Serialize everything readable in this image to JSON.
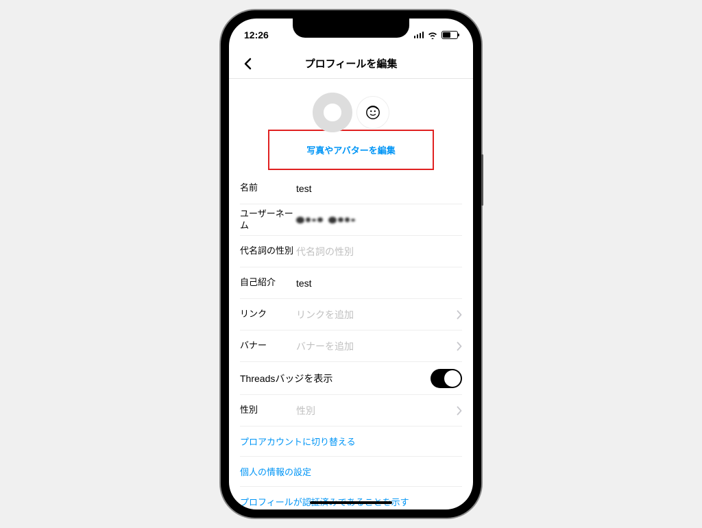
{
  "status": {
    "time": "12:26"
  },
  "nav": {
    "title": "プロフィールを編集"
  },
  "avatar": {
    "edit_link": "写真やアバターを編集"
  },
  "fields": {
    "name": {
      "label": "名前",
      "value": "test"
    },
    "username": {
      "label": "ユーザーネーム"
    },
    "pronouns": {
      "label": "代名詞の性別",
      "placeholder": "代名詞の性別"
    },
    "bio": {
      "label": "自己紹介",
      "value": "test"
    },
    "links": {
      "label": "リンク",
      "placeholder": "リンクを追加"
    },
    "banner": {
      "label": "バナー",
      "placeholder": "バナーを追加"
    },
    "threads": {
      "label": "Threadsバッジを表示"
    },
    "gender": {
      "label": "性別",
      "placeholder": "性別"
    }
  },
  "actions": {
    "switch_pro": "プロアカウントに切り替える",
    "personal_info": "個人の情報の設定",
    "verified": "プロフィールが認証済みであることを示す"
  }
}
